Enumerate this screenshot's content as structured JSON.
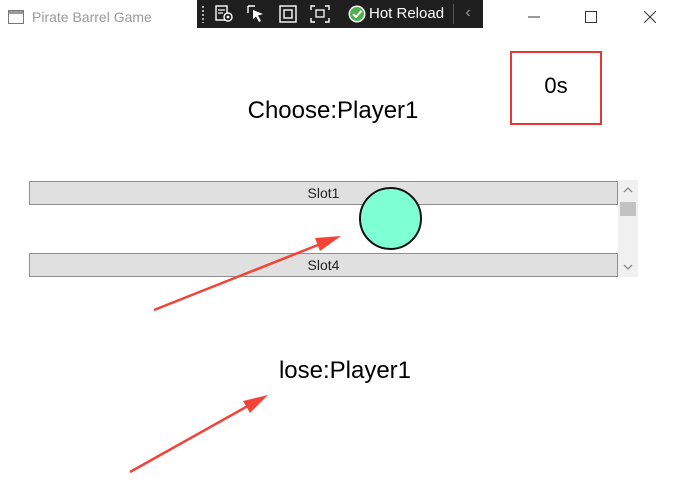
{
  "window": {
    "title": "Pirate Barrel Game",
    "controls": [
      "minimize",
      "maximize",
      "close"
    ]
  },
  "dev_toolbar": {
    "buttons": [
      "live-visual-tree-icon",
      "select-element-icon",
      "display-layout-adorners-icon",
      "track-focused-element-icon"
    ],
    "hot_reload_label": "Hot Reload",
    "hot_reload_status_color": "#4caf50",
    "collapse_glyph": "‹"
  },
  "timer": {
    "text": "0s",
    "border_color": "#e53935"
  },
  "choose": {
    "text": "Choose:Player1"
  },
  "slot_list": {
    "items": [
      {
        "label": "Slot1"
      },
      {
        "label": "Slot4"
      }
    ]
  },
  "ball": {
    "color": "#7fffd4"
  },
  "lose": {
    "text": "lose:Player1"
  },
  "annotation_color": "#f44336"
}
